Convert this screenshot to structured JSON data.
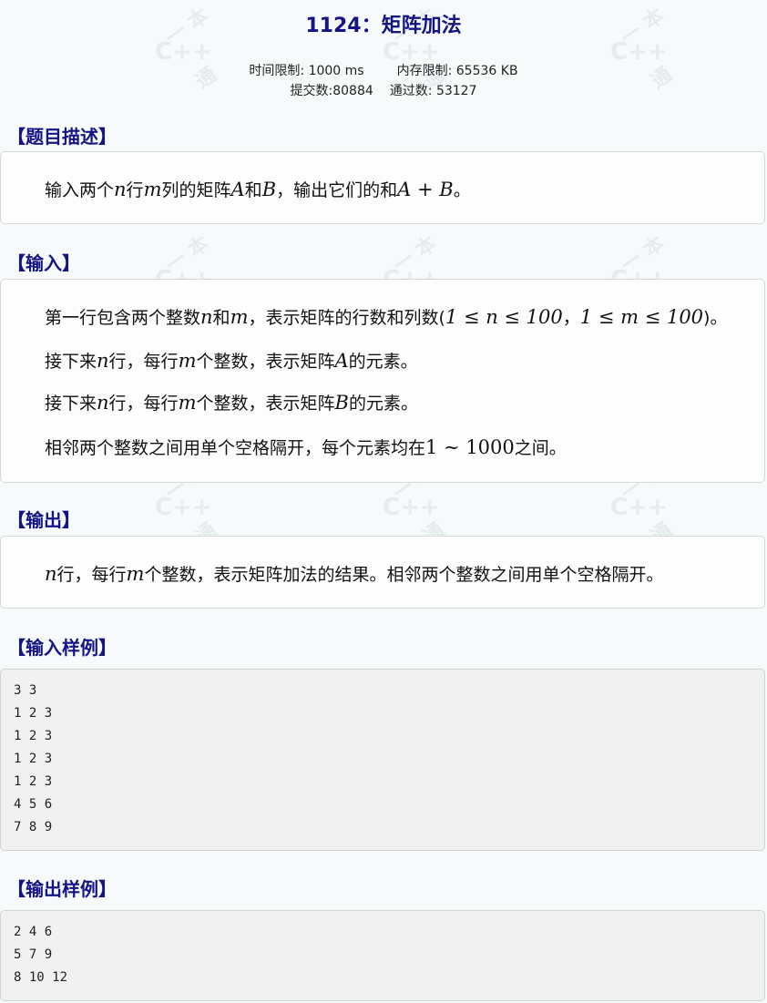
{
  "problem": {
    "title": "1124：矩阵加法"
  },
  "limits": {
    "time_label": "时间限制: 1000 ms",
    "memory_label": "内存限制: 65536 KB",
    "submit_label": "提交数:80884",
    "pass_label": "通过数: 53127"
  },
  "watermark": {
    "text": "C++",
    "glyph_top": "一",
    "glyph_bottom": "本",
    "glyph_side": "通"
  },
  "description": {
    "heading": "【题目描述】",
    "line": {
      "p1": "输入两个",
      "n": "n",
      "p2": "行",
      "m": "m",
      "p3": "列的矩阵",
      "A": "A",
      "p4": "和",
      "B": "B",
      "p5": "，输出它们的和",
      "sum": "A + B",
      "p6": "。"
    }
  },
  "input": {
    "heading": "【输入】",
    "line1": {
      "p1": "第一行包含两个整数",
      "n": "n",
      "p2": "和",
      "m": "m",
      "p3": "，表示矩阵的行数和列数(",
      "range_n": "1 ≤ n ≤ 100",
      "p4": "，",
      "range_m": "1 ≤ m ≤ 100",
      "p5": ")。"
    },
    "line2": {
      "p1": "接下来",
      "n": "n",
      "p2": "行，每行",
      "m": "m",
      "p3": "个整数，表示矩阵",
      "A": "A",
      "p4": "的元素。"
    },
    "line3": {
      "p1": "接下来",
      "n": "n",
      "p2": "行，每行",
      "m": "m",
      "p3": "个整数，表示矩阵",
      "B": "B",
      "p4": "的元素。"
    },
    "line4": {
      "p1": "相邻两个整数之间用单个空格隔开，每个元素均在",
      "range": "1 ∼ 1000",
      "p2": "之间。"
    }
  },
  "output": {
    "heading": "【输出】",
    "line": {
      "n": "n",
      "p1": "行，每行",
      "m": "m",
      "p2": "个整数，表示矩阵加法的结果。相邻两个整数之间用单个空格隔开。"
    }
  },
  "sample_input": {
    "heading": "【输入样例】",
    "lines": [
      "3 3",
      "1 2 3",
      "1 2 3",
      "1 2 3",
      "1 2 3",
      "4 5 6",
      "7 8 9"
    ]
  },
  "sample_output": {
    "heading": "【输出样例】",
    "lines": [
      "2 4 6",
      "5 7 9",
      "8 10 12"
    ]
  }
}
